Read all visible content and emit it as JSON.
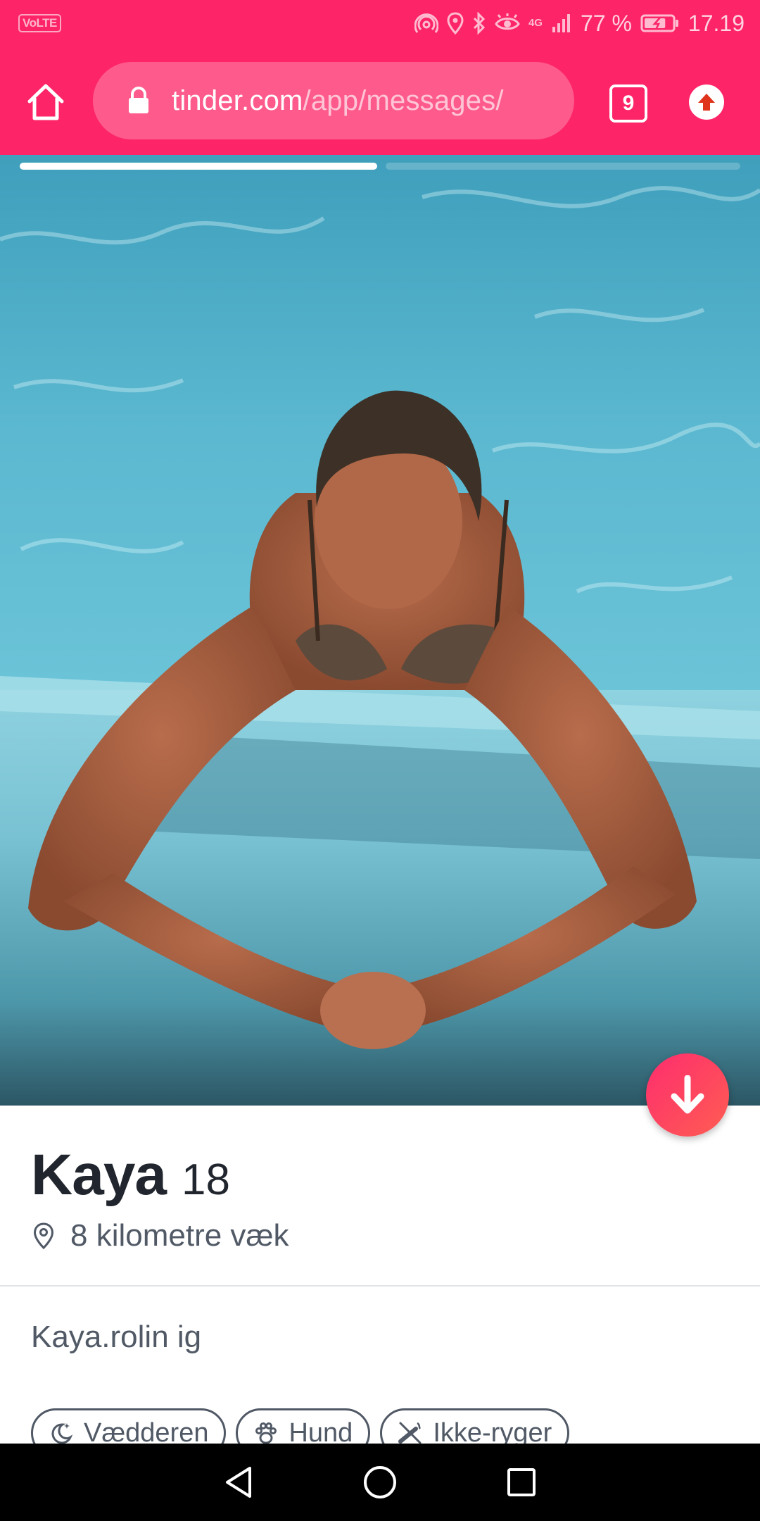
{
  "status_bar": {
    "network_badge": "VoLTE",
    "signal_label": "4G",
    "battery_percent": "77 %",
    "time": "17.19",
    "battery_level": 0.77
  },
  "browser": {
    "url_host": "tinder.com",
    "url_path": "/app/messages/",
    "tab_count": "9"
  },
  "photo": {
    "progress_fraction": 0.5
  },
  "profile": {
    "name": "Kaya",
    "age": "18",
    "distance": "8 kilometre væk",
    "bio": "Kaya.rolin ig",
    "chips": [
      {
        "label": "Vædderen",
        "icon": "moon-stars-icon"
      },
      {
        "label": "Hund",
        "icon": "paw-icon"
      },
      {
        "label": "Ikke-ryger",
        "icon": "cigarette-icon"
      }
    ]
  },
  "colors": {
    "brand": "#fd2468",
    "pill": "#fe5b8c",
    "gradient_start": "#fd2d6e",
    "gradient_end": "#ff5d52"
  }
}
